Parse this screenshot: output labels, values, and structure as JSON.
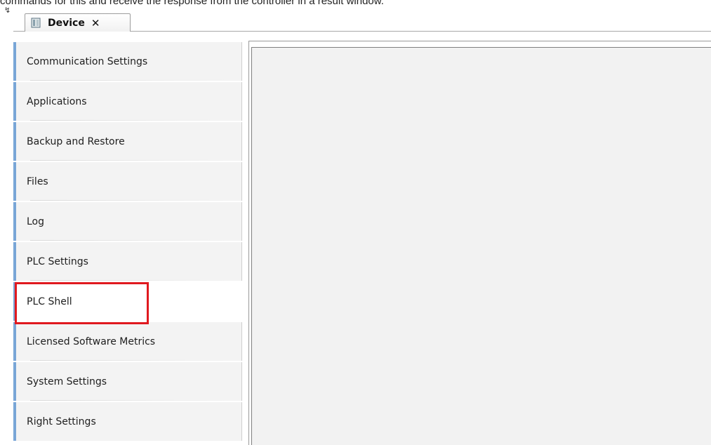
{
  "caption": "commands for this and receive the response from the controller in a result window.",
  "tab": {
    "title": "Device",
    "close_label": "✕",
    "icon": "device-icon"
  },
  "nav": {
    "items": [
      {
        "label": "Communication Settings"
      },
      {
        "label": "Applications"
      },
      {
        "label": "Backup and Restore"
      },
      {
        "label": "Files"
      },
      {
        "label": "Log"
      },
      {
        "label": "PLC Settings"
      },
      {
        "label": "PLC Shell",
        "selected": true
      },
      {
        "label": "Licensed Software Metrics"
      },
      {
        "label": "System Settings"
      },
      {
        "label": "Right Settings"
      }
    ]
  },
  "colors": {
    "highlight": "#e0191f",
    "nav_accent": "#79a6d7",
    "nav_bg": "#f3f3f3",
    "panel_bg": "#f2f2f2"
  }
}
